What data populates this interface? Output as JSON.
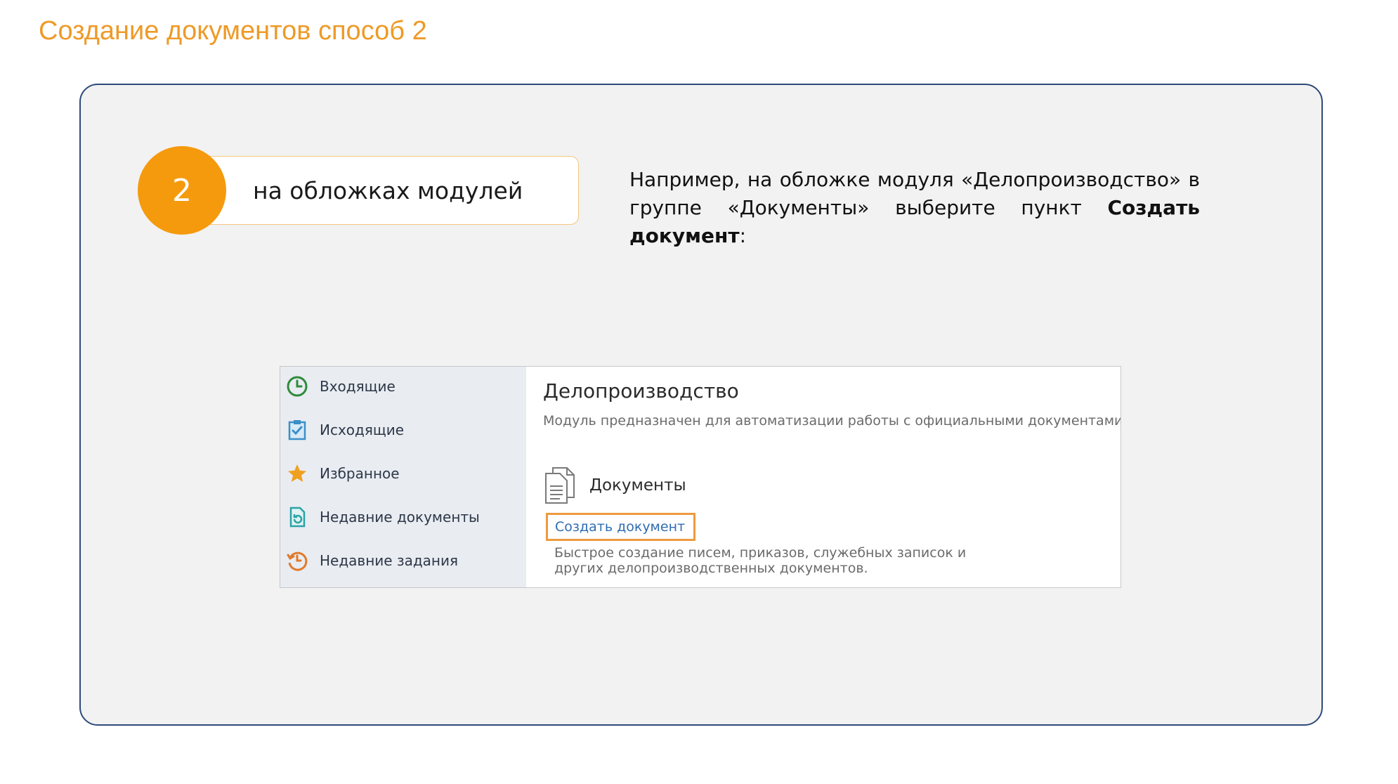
{
  "slide": {
    "title": "Создание документов способ 2"
  },
  "step": {
    "number": "2",
    "label": "на обложках модулей"
  },
  "instruction": {
    "part1": "Например, на обложке модуля «Делопроизводство» в группе «Документы» выберите пункт ",
    "bold": "Создать документ",
    "part2": ":"
  },
  "screenshot": {
    "sidebar": {
      "items": [
        {
          "label": "Входящие",
          "icon": "clock-icon"
        },
        {
          "label": "Исходящие",
          "icon": "checklist-icon"
        },
        {
          "label": "Избранное",
          "icon": "star-icon"
        },
        {
          "label": "Недавние документы",
          "icon": "recent-document-icon"
        },
        {
          "label": "Недавние задания",
          "icon": "history-clock-icon"
        }
      ]
    },
    "module": {
      "title": "Делопроизводство",
      "description": "Модуль предназначен для автоматизации работы с официальными документами."
    },
    "group": {
      "title": "Документы",
      "icon": "documents-icon"
    },
    "action": {
      "link": "Создать документ",
      "description": "Быстрое создание писем, приказов, служебных записок и других делопроизводственных документов."
    }
  },
  "colors": {
    "title": "#ee9a27",
    "accent": "#f59a0d",
    "panel_border": "#2e4a7a",
    "highlight": "#ee9a3f",
    "link": "#2f6db3"
  }
}
